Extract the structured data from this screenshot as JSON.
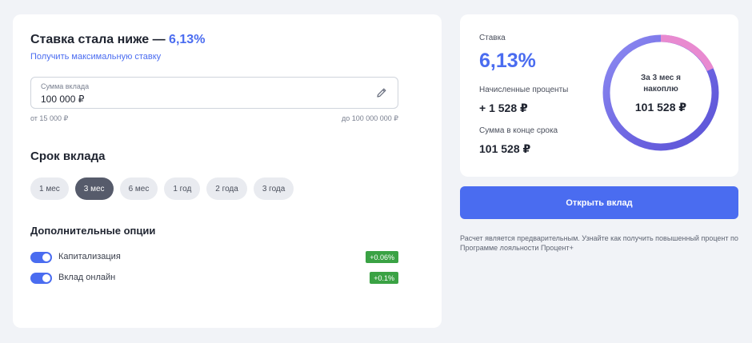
{
  "header": {
    "title_prefix": "Ставка стала ниже — ",
    "title_rate": "6,13%",
    "max_rate_link": "Получить максимальную ставку"
  },
  "amount": {
    "label": "Сумма вклада",
    "value": "100 000 ₽",
    "min": "от 15 000 ₽",
    "max": "до 100 000 000 ₽"
  },
  "term": {
    "title": "Срок вклада",
    "options": [
      "1 мес",
      "3 мес",
      "6 мес",
      "1 год",
      "2 года",
      "3 года"
    ],
    "selected": "3 мес"
  },
  "options": {
    "title": "Дополнительные опции",
    "items": [
      {
        "label": "Капитализация",
        "badge": "+0.06%",
        "enabled": true
      },
      {
        "label": "Вклад онлайн",
        "badge": "+0.1%",
        "enabled": true
      }
    ]
  },
  "summary": {
    "rate_label": "Ставка",
    "rate": "6,13%",
    "interest_label": "Начисленные проценты",
    "interest": "+ 1 528 ₽",
    "end_label": "Сумма в конце срока",
    "end_sum": "101 528 ₽",
    "ring_caption": "За 3 мес я накоплю",
    "ring_value": "101 528 ₽"
  },
  "cta": {
    "open_label": "Открыть вклад"
  },
  "disclaimer": "Расчет является предварительным. Узнайте как получить повышенный процент по Программе лояльности Процент+",
  "colors": {
    "accent": "#4a6cf0",
    "badge": "#3aa244",
    "ring_pink": "#e88ad0"
  }
}
